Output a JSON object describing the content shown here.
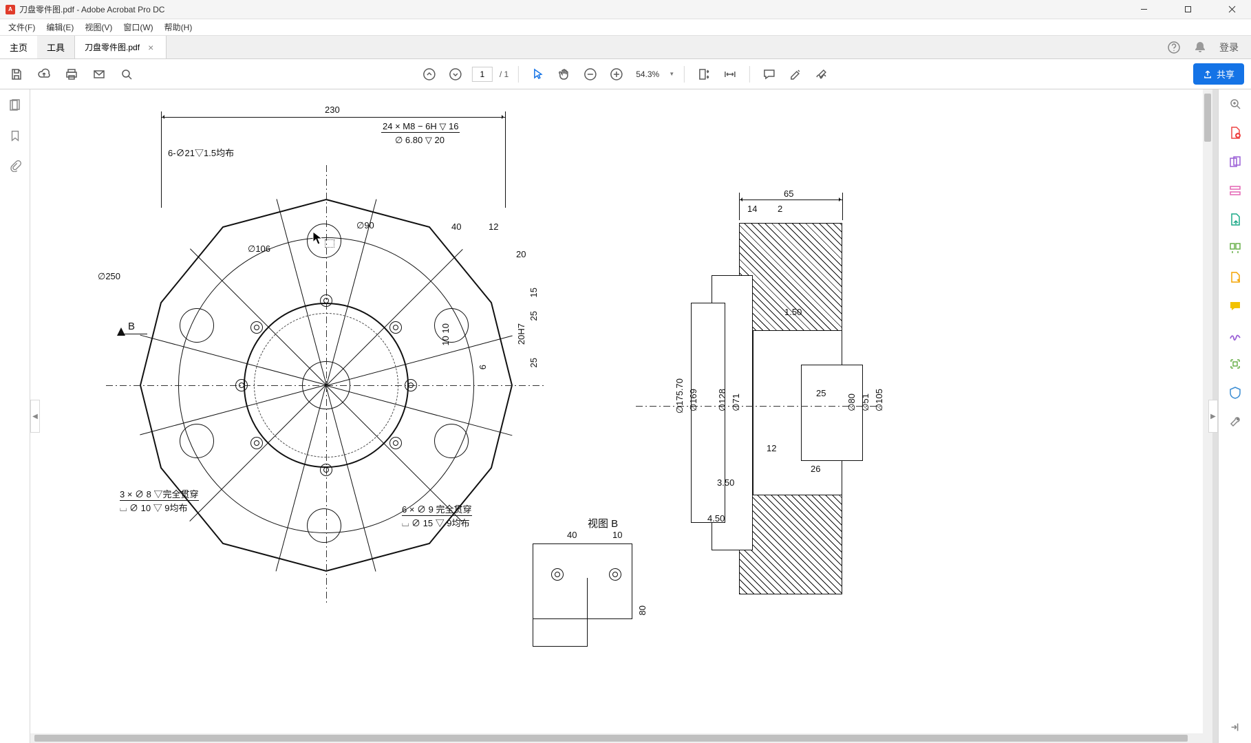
{
  "app": {
    "title": "刀盘零件图.pdf - Adobe Acrobat Pro DC"
  },
  "menu": {
    "file": "文件(F)",
    "edit": "编辑(E)",
    "view": "视图(V)",
    "window": "窗口(W)",
    "help": "帮助(H)"
  },
  "tabs": {
    "home": "主页",
    "tools": "工具",
    "doc": "刀盘零件图.pdf"
  },
  "header_right": {
    "login": "登录"
  },
  "toolbar": {
    "page_current": "1",
    "page_total": "/ 1",
    "zoom": "54.3%",
    "share": "共享"
  },
  "drawing": {
    "front": {
      "dim_230": "230",
      "thread_spec_1": "24 × M8 − 6H ▽ 16",
      "thread_spec_2": "∅ 6.80 ▽ 20",
      "hole_spec": "6-∅21▽1.5均布",
      "d250": "∅250",
      "d106": "∅106",
      "d90": "∅90",
      "dim_40": "40",
      "dim_12": "12",
      "dim_20": "20",
      "dim_15": "15",
      "dim_25a": "25",
      "fit_20H7": "20H7",
      "dim_1010": "10 10",
      "dim_6": "6",
      "dim_25b": "25",
      "section_B": "B",
      "note3x8_1": "3 × ∅ 8 ▽完全贯穿",
      "note3x8_2": "⌴ ∅ 10 ▽ 9均布",
      "note6x9_1": "6 × ∅ 9 完全贯穿",
      "note6x9_2": "⌴ ∅ 15 ▽ 9均布"
    },
    "side": {
      "dim_65": "65",
      "dim_14": "14",
      "dim_2": "2",
      "dim_1_50": "1.50",
      "dim_25": "25",
      "dim_12": "12",
      "dim_26": "26",
      "dim_3_50": "3.50",
      "dim_4_50": "4.50",
      "d175_70": "∅175.70",
      "d169": "∅169",
      "d128": "∅128",
      "d71": "∅71",
      "d80": "∅80",
      "d51": "∅51",
      "d105": "∅105"
    },
    "detail": {
      "title": "视图 B",
      "dim_40": "40",
      "dim_10": "10",
      "dim_80": "80"
    }
  }
}
